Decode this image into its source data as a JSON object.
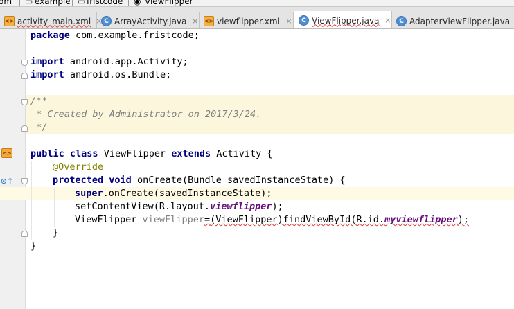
{
  "breadcrumb": {
    "items": [
      {
        "label": "om"
      },
      {
        "label": "example"
      },
      {
        "label": "fristcode"
      },
      {
        "label": "ViewFlipper"
      }
    ]
  },
  "tabs": [
    {
      "label": "activity_main.xml",
      "icon": "xml-file-icon",
      "active": false
    },
    {
      "label": "ArrayActivity.java",
      "icon": "java-class-icon",
      "active": false
    },
    {
      "label": "viewflipper.xml",
      "icon": "xml-file-icon",
      "active": false
    },
    {
      "label": "ViewFlipper.java",
      "icon": "java-class-icon",
      "active": true
    },
    {
      "label": "AdapterViewFlipper.java",
      "icon": "java-class-icon",
      "active": false
    }
  ],
  "tab_icon_letter": "C",
  "tab_xml_letter": "<>",
  "close_glyph": "×",
  "code": {
    "line1": {
      "kw": "package",
      "rest": " com.example.fristcode;"
    },
    "line3": {
      "kw": "import",
      "rest": " android.app.Activity;"
    },
    "line4": {
      "kw": "import",
      "rest": " android.os.Bundle;"
    },
    "line6": "/**",
    "line7": " * Created by Administrator on 2017/3/24.",
    "line8": " */",
    "line10": {
      "kw1": "public",
      "kw2": "class",
      "name": " ViewFlipper ",
      "kw3": "extends",
      "rest": " Activity {"
    },
    "line11": "@Override",
    "line12": {
      "kw1": "protected",
      "kw2": "void",
      "rest": " onCreate(Bundle savedInstanceState) {"
    },
    "line13": {
      "kw": "super",
      "rest": ".onCreate(savedInstanceState);"
    },
    "line14": {
      "a": "setContentView(R.layout.",
      "field": "viewflipper",
      "b": ");"
    },
    "line15": {
      "type": "ViewFlipper ",
      "var": "viewFlipper",
      "a": "=",
      "cast": "(ViewFlipper)",
      "b": "findViewById(R.id.",
      "field": "myviewflipper",
      "c": ");"
    },
    "line16": "}",
    "line17": "}"
  },
  "colors": {
    "keyword": "#000080",
    "annotation": "#808000",
    "doc_comment": "#808080",
    "static_field": "#660e7a",
    "doc_background": "#fbf6dc",
    "caret_row": "#fffae3",
    "active_tab": "#ffffff",
    "tab_bar": "#e4e4e4"
  }
}
